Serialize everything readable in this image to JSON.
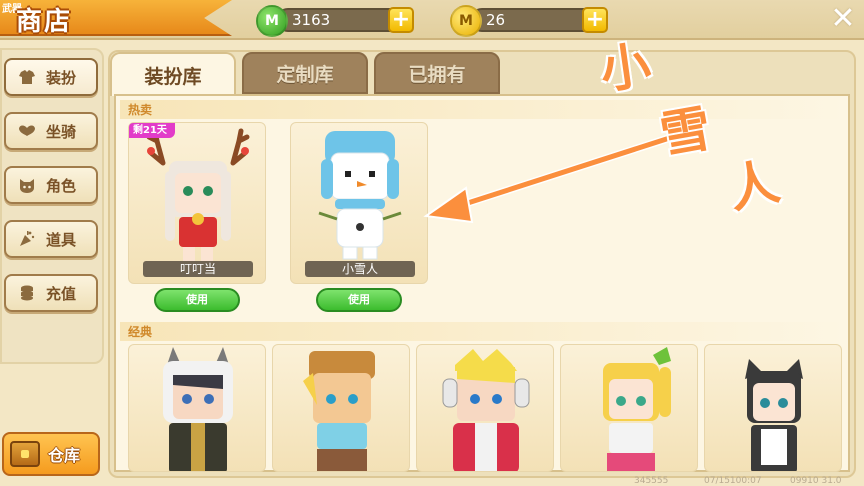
{
  "header": {
    "title_tag": "武器",
    "title": "商店",
    "mini_coins": "3163",
    "gold_coins": "26",
    "mini_coin_symbol": "M",
    "gold_coin_symbol": "M",
    "plus": "+",
    "close": "✕"
  },
  "sidebar": {
    "items": [
      {
        "label": "装扮",
        "icon": "shirt-icon"
      },
      {
        "label": "坐骑",
        "icon": "wings-icon"
      },
      {
        "label": "角色",
        "icon": "cat-face-icon"
      },
      {
        "label": "道具",
        "icon": "confetti-icon"
      },
      {
        "label": "充值",
        "icon": "coin-stack-icon"
      }
    ],
    "warehouse": "仓库"
  },
  "tabs": [
    {
      "label": "装扮库",
      "active": true
    },
    {
      "label": "定制库",
      "active": false
    },
    {
      "label": "已拥有",
      "active": false
    }
  ],
  "sections": {
    "hot": "热卖",
    "classic": "经典"
  },
  "hot_items": [
    {
      "name": "叮叮当",
      "badge": "剩21天",
      "button": "使用"
    },
    {
      "name": "小雪人",
      "badge": "",
      "button": "使用"
    }
  ],
  "annotation": {
    "line1": "小",
    "line2": "雪",
    "line3": "人"
  },
  "footer": {
    "a": "345555",
    "b": "07/15100:07",
    "c": "09910 31.0"
  },
  "colors": {
    "accent_orange": "#f59b1e",
    "use_green": "#3cbc2e",
    "annotation": "#fb8f3d",
    "badge_pink": "#e23cc9"
  }
}
